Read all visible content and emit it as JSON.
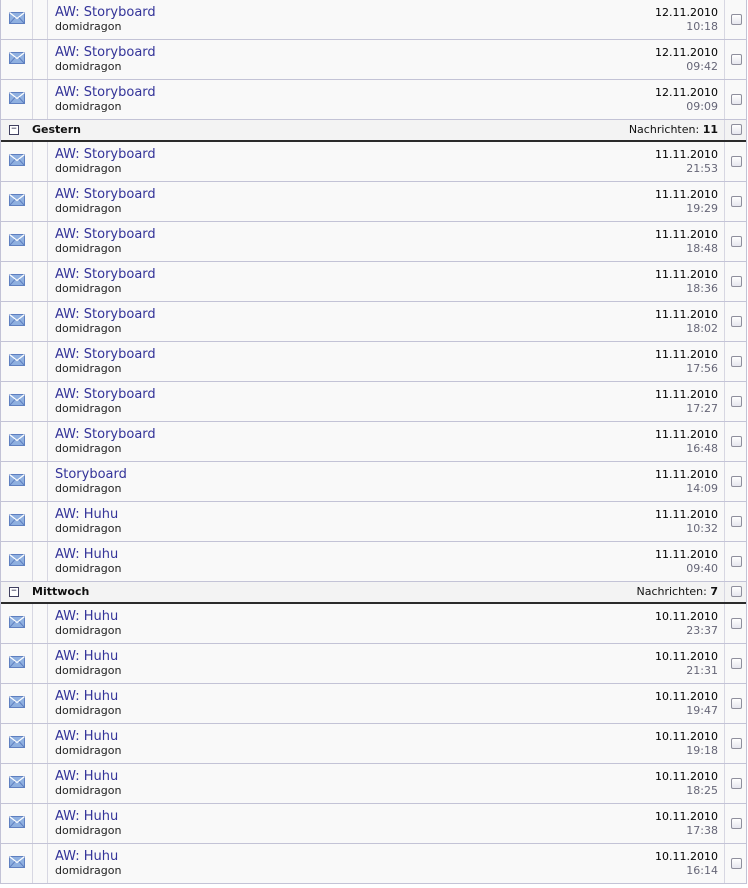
{
  "colors": {
    "subject": "#333399",
    "row_bg": "#f9f9f9",
    "border": "#c3c3d6",
    "header_rule": "#2b2b2b",
    "time": "#666677"
  },
  "icons": {
    "message": "envelope-icon",
    "group_toggle": "collapse-minus-icon"
  },
  "blocks": [
    {
      "type": "message",
      "subject": "AW: Storyboard",
      "sender": "domidragon",
      "date": "12.11.2010",
      "time": "10:18"
    },
    {
      "type": "message",
      "subject": "AW: Storyboard",
      "sender": "domidragon",
      "date": "12.11.2010",
      "time": "09:42"
    },
    {
      "type": "message",
      "subject": "AW: Storyboard",
      "sender": "domidragon",
      "date": "12.11.2010",
      "time": "09:09"
    },
    {
      "type": "group",
      "title": "Gestern",
      "count_label": "Nachrichten:",
      "count": "11",
      "toggle": "−"
    },
    {
      "type": "message",
      "subject": "AW: Storyboard",
      "sender": "domidragon",
      "date": "11.11.2010",
      "time": "21:53"
    },
    {
      "type": "message",
      "subject": "AW: Storyboard",
      "sender": "domidragon",
      "date": "11.11.2010",
      "time": "19:29"
    },
    {
      "type": "message",
      "subject": "AW: Storyboard",
      "sender": "domidragon",
      "date": "11.11.2010",
      "time": "18:48"
    },
    {
      "type": "message",
      "subject": "AW: Storyboard",
      "sender": "domidragon",
      "date": "11.11.2010",
      "time": "18:36"
    },
    {
      "type": "message",
      "subject": "AW: Storyboard",
      "sender": "domidragon",
      "date": "11.11.2010",
      "time": "18:02"
    },
    {
      "type": "message",
      "subject": "AW: Storyboard",
      "sender": "domidragon",
      "date": "11.11.2010",
      "time": "17:56"
    },
    {
      "type": "message",
      "subject": "AW: Storyboard",
      "sender": "domidragon",
      "date": "11.11.2010",
      "time": "17:27"
    },
    {
      "type": "message",
      "subject": "AW: Storyboard",
      "sender": "domidragon",
      "date": "11.11.2010",
      "time": "16:48"
    },
    {
      "type": "message",
      "subject": "Storyboard",
      "sender": "domidragon",
      "date": "11.11.2010",
      "time": "14:09"
    },
    {
      "type": "message",
      "subject": "AW: Huhu",
      "sender": "domidragon",
      "date": "11.11.2010",
      "time": "10:32"
    },
    {
      "type": "message",
      "subject": "AW: Huhu",
      "sender": "domidragon",
      "date": "11.11.2010",
      "time": "09:40"
    },
    {
      "type": "group",
      "title": "Mittwoch",
      "count_label": "Nachrichten:",
      "count": "7",
      "toggle": "−"
    },
    {
      "type": "message",
      "subject": "AW: Huhu",
      "sender": "domidragon",
      "date": "10.11.2010",
      "time": "23:37"
    },
    {
      "type": "message",
      "subject": "AW: Huhu",
      "sender": "domidragon",
      "date": "10.11.2010",
      "time": "21:31"
    },
    {
      "type": "message",
      "subject": "AW: Huhu",
      "sender": "domidragon",
      "date": "10.11.2010",
      "time": "19:47"
    },
    {
      "type": "message",
      "subject": "AW: Huhu",
      "sender": "domidragon",
      "date": "10.11.2010",
      "time": "19:18"
    },
    {
      "type": "message",
      "subject": "AW: Huhu",
      "sender": "domidragon",
      "date": "10.11.2010",
      "time": "18:25"
    },
    {
      "type": "message",
      "subject": "AW: Huhu",
      "sender": "domidragon",
      "date": "10.11.2010",
      "time": "17:38"
    },
    {
      "type": "message",
      "subject": "AW: Huhu",
      "sender": "domidragon",
      "date": "10.11.2010",
      "time": "16:14"
    }
  ]
}
